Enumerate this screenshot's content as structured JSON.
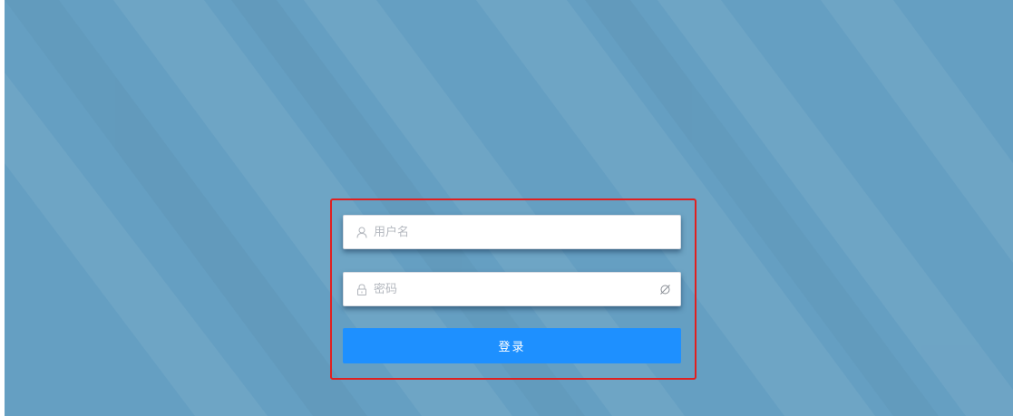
{
  "login_form": {
    "username": {
      "placeholder": "用户名",
      "value": "",
      "icon": "user-icon"
    },
    "password": {
      "placeholder": "密码",
      "value": "",
      "icon": "lock-icon",
      "toggle_icon": "eye-off-icon"
    },
    "submit_label": "登录"
  },
  "colors": {
    "background": "#659fc2",
    "button": "#1e90ff",
    "highlight_border": "#e02020"
  }
}
